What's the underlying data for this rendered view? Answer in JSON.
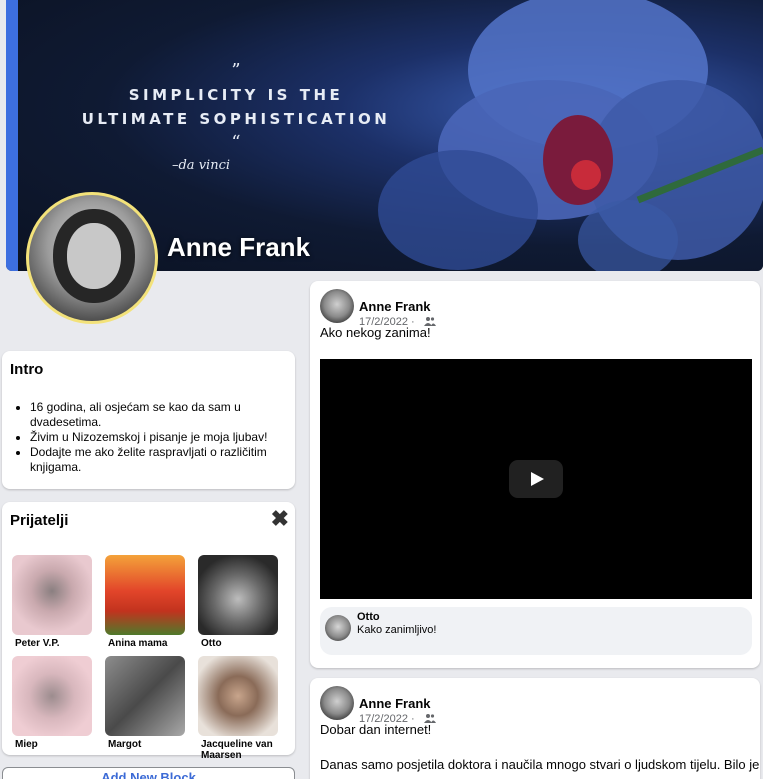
{
  "cover": {
    "quote_mark_open": "”",
    "quote_line1": "SIMPLICITY IS THE",
    "quote_line2": "ULTIMATE SOPHISTICATION",
    "quote_mark_close": "“",
    "quote_author": "–da vinci"
  },
  "profile": {
    "name": "Anne Frank"
  },
  "intro": {
    "title": "Intro",
    "items": [
      "16 godina, ali osjećam se kao da sam u dvadesetima.",
      "Živim u Nizozemskoj i pisanje je moja ljubav!",
      "Dodajte me ako želite raspravljati o različitim knjigama."
    ]
  },
  "friends": {
    "title": "Prijatelji",
    "close": "✖",
    "list": [
      {
        "name": "Peter V.P.",
        "color": "#e9c9cf"
      },
      {
        "name": "Anina mama",
        "color": "#e36b2c"
      },
      {
        "name": "Otto",
        "color": "#3a3a3a"
      },
      {
        "name": "Miep",
        "color": "#efcdd3"
      },
      {
        "name": "Margot",
        "color": "#5b5b5b"
      },
      {
        "name": "Jacqueline van Maarsen",
        "color": "#cfc6be"
      }
    ]
  },
  "add_block": "Add New Block",
  "posts": [
    {
      "author": "Anne Frank",
      "date": "17/2/2022 ·",
      "text": "Ako nekog zanima!",
      "comment": {
        "author": "Otto",
        "text": "Kako zanimljivo!"
      }
    },
    {
      "author": "Anne Frank",
      "date": "17/2/2022 ·",
      "text": "Dobar dan internet!",
      "text2": "Danas samo posjetila doktora i naučila mnogo stvari o ljudskom tijelu. Bilo je"
    }
  ],
  "icons": {
    "audience": "friends-icon",
    "play": "play-icon"
  }
}
